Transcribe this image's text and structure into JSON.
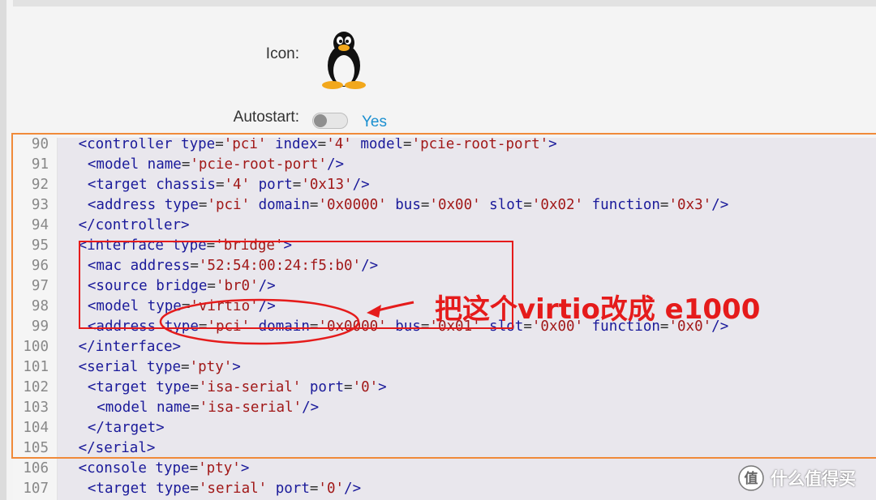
{
  "form": {
    "icon_label": "Icon:",
    "icon_name": "linux-penguin-icon",
    "autostart_label": "Autostart:",
    "autostart_value": "Yes",
    "autostart_on": false
  },
  "colors": {
    "accent": "#1a8fd0",
    "highlight_box": "#f08a3a",
    "annotation": "#e51b1b"
  },
  "annotation": {
    "text": "把这个virtio改成 e1000"
  },
  "watermark": {
    "icon": "zhidemai-logo",
    "text": "什么值得买"
  },
  "editor": {
    "lines": [
      {
        "n": "90",
        "indent": 2,
        "tokens": [
          [
            "tag",
            "<controller "
          ],
          [
            "attr",
            "type"
          ],
          [
            "eq",
            "="
          ],
          [
            "str",
            "'pci'"
          ],
          [
            "attr",
            " index"
          ],
          [
            "eq",
            "="
          ],
          [
            "str",
            "'4'"
          ],
          [
            "attr",
            " model"
          ],
          [
            "eq",
            "="
          ],
          [
            "str",
            "'pcie-root-port'"
          ],
          [
            "tag",
            ">"
          ]
        ]
      },
      {
        "n": "91",
        "indent": 3,
        "tokens": [
          [
            "tag",
            "<model "
          ],
          [
            "attr",
            "name"
          ],
          [
            "eq",
            "="
          ],
          [
            "str",
            "'pcie-root-port'"
          ],
          [
            "tag",
            "/>"
          ]
        ]
      },
      {
        "n": "92",
        "indent": 3,
        "tokens": [
          [
            "tag",
            "<target "
          ],
          [
            "attr",
            "chassis"
          ],
          [
            "eq",
            "="
          ],
          [
            "str",
            "'4'"
          ],
          [
            "attr",
            " port"
          ],
          [
            "eq",
            "="
          ],
          [
            "str",
            "'0x13'"
          ],
          [
            "tag",
            "/>"
          ]
        ]
      },
      {
        "n": "93",
        "indent": 3,
        "tokens": [
          [
            "tag",
            "<address "
          ],
          [
            "attr",
            "type"
          ],
          [
            "eq",
            "="
          ],
          [
            "str",
            "'pci'"
          ],
          [
            "attr",
            " domain"
          ],
          [
            "eq",
            "="
          ],
          [
            "str",
            "'0x0000'"
          ],
          [
            "attr",
            " bus"
          ],
          [
            "eq",
            "="
          ],
          [
            "str",
            "'0x00'"
          ],
          [
            "attr",
            " slot"
          ],
          [
            "eq",
            "="
          ],
          [
            "str",
            "'0x02'"
          ],
          [
            "attr",
            " function"
          ],
          [
            "eq",
            "="
          ],
          [
            "str",
            "'0x3'"
          ],
          [
            "tag",
            "/>"
          ]
        ]
      },
      {
        "n": "94",
        "indent": 2,
        "tokens": [
          [
            "tag",
            "</controller>"
          ]
        ]
      },
      {
        "n": "95",
        "indent": 2,
        "tokens": [
          [
            "tag",
            "<interface "
          ],
          [
            "attr",
            "type"
          ],
          [
            "eq",
            "="
          ],
          [
            "str",
            "'bridge'"
          ],
          [
            "tag",
            ">"
          ]
        ]
      },
      {
        "n": "96",
        "indent": 3,
        "tokens": [
          [
            "tag",
            "<mac "
          ],
          [
            "attr",
            "address"
          ],
          [
            "eq",
            "="
          ],
          [
            "str",
            "'52:54:00:24:f5:b0'"
          ],
          [
            "tag",
            "/>"
          ]
        ]
      },
      {
        "n": "97",
        "indent": 3,
        "tokens": [
          [
            "tag",
            "<source "
          ],
          [
            "attr",
            "bridge"
          ],
          [
            "eq",
            "="
          ],
          [
            "str",
            "'br0'"
          ],
          [
            "tag",
            "/>"
          ]
        ]
      },
      {
        "n": "98",
        "indent": 3,
        "tokens": [
          [
            "tag",
            "<model "
          ],
          [
            "attr",
            "type"
          ],
          [
            "eq",
            "="
          ],
          [
            "str",
            "'virtio'"
          ],
          [
            "tag",
            "/>"
          ]
        ]
      },
      {
        "n": "99",
        "indent": 3,
        "tokens": [
          [
            "tag",
            "<address "
          ],
          [
            "attr",
            "type"
          ],
          [
            "eq",
            "="
          ],
          [
            "str",
            "'pci'"
          ],
          [
            "attr",
            " domain"
          ],
          [
            "eq",
            "="
          ],
          [
            "str",
            "'0x0000'"
          ],
          [
            "attr",
            " bus"
          ],
          [
            "eq",
            "="
          ],
          [
            "str",
            "'0x01'"
          ],
          [
            "attr",
            " slot"
          ],
          [
            "eq",
            "="
          ],
          [
            "str",
            "'0x00'"
          ],
          [
            "attr",
            " function"
          ],
          [
            "eq",
            "="
          ],
          [
            "str",
            "'0x0'"
          ],
          [
            "tag",
            "/>"
          ]
        ]
      },
      {
        "n": "100",
        "indent": 2,
        "tokens": [
          [
            "tag",
            "</interface>"
          ]
        ]
      },
      {
        "n": "101",
        "indent": 2,
        "tokens": [
          [
            "tag",
            "<serial "
          ],
          [
            "attr",
            "type"
          ],
          [
            "eq",
            "="
          ],
          [
            "str",
            "'pty'"
          ],
          [
            "tag",
            ">"
          ]
        ]
      },
      {
        "n": "102",
        "indent": 3,
        "tokens": [
          [
            "tag",
            "<target "
          ],
          [
            "attr",
            "type"
          ],
          [
            "eq",
            "="
          ],
          [
            "str",
            "'isa-serial'"
          ],
          [
            "attr",
            " port"
          ],
          [
            "eq",
            "="
          ],
          [
            "str",
            "'0'"
          ],
          [
            "tag",
            ">"
          ]
        ]
      },
      {
        "n": "103",
        "indent": 4,
        "tokens": [
          [
            "tag",
            "<model "
          ],
          [
            "attr",
            "name"
          ],
          [
            "eq",
            "="
          ],
          [
            "str",
            "'isa-serial'"
          ],
          [
            "tag",
            "/>"
          ]
        ]
      },
      {
        "n": "104",
        "indent": 3,
        "tokens": [
          [
            "tag",
            "</target>"
          ]
        ]
      },
      {
        "n": "105",
        "indent": 2,
        "tokens": [
          [
            "tag",
            "</serial>"
          ]
        ]
      },
      {
        "n": "106",
        "indent": 2,
        "tokens": [
          [
            "tag",
            "<console "
          ],
          [
            "attr",
            "type"
          ],
          [
            "eq",
            "="
          ],
          [
            "str",
            "'pty'"
          ],
          [
            "tag",
            ">"
          ]
        ]
      },
      {
        "n": "107",
        "indent": 3,
        "tokens": [
          [
            "tag",
            "<target "
          ],
          [
            "attr",
            "type"
          ],
          [
            "eq",
            "="
          ],
          [
            "str",
            "'serial'"
          ],
          [
            "attr",
            " port"
          ],
          [
            "eq",
            "="
          ],
          [
            "str",
            "'0'"
          ],
          [
            "tag",
            "/>"
          ]
        ]
      }
    ]
  }
}
